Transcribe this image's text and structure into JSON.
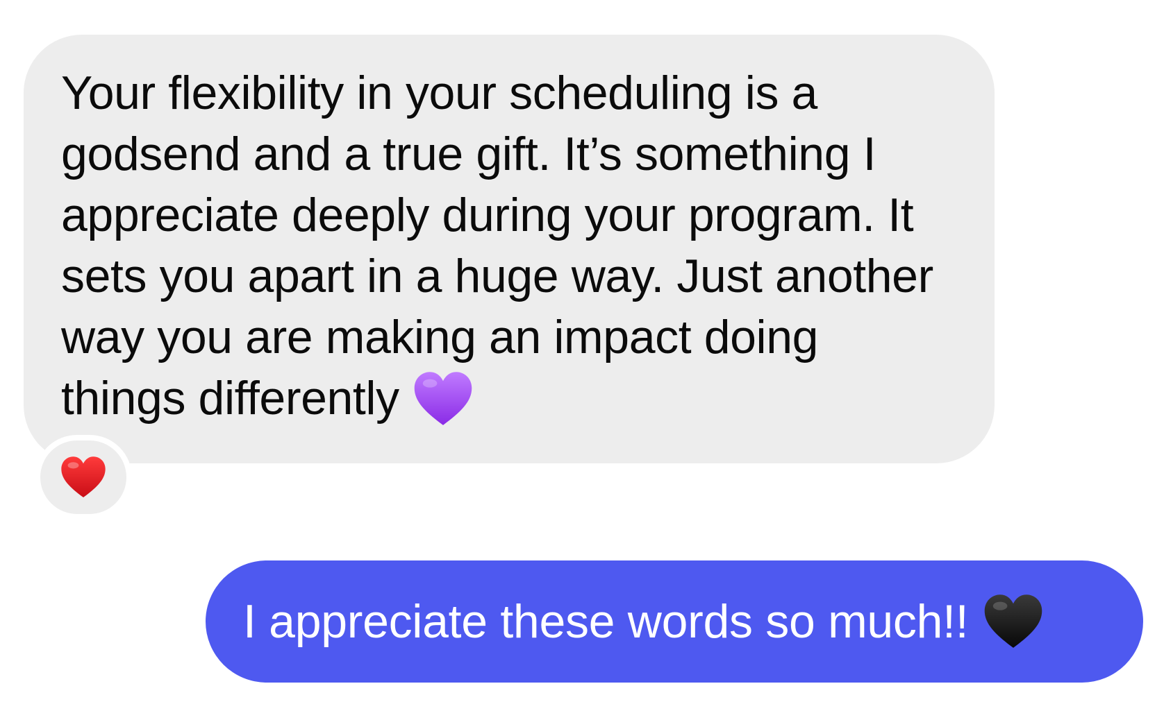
{
  "messages": [
    {
      "direction": "incoming",
      "text": "Your flexibility in your scheduling is a godsend and a true gift. It’s something I appreciate deeply during your program. It sets you apart in a huge way. Just another way you are making an impact doing things differently",
      "trailing_icon": "purple-heart-emoji",
      "reaction": "red-heart-emoji",
      "bubble_color": "#ededed"
    },
    {
      "direction": "outgoing",
      "text": "I appreciate these words so much!!",
      "trailing_icon": "black-heart-emoji",
      "bubble_color": "#4e59f0"
    }
  ],
  "colors": {
    "purple_heart": "#a24cf0",
    "red_heart": "#e3141d",
    "black_heart": "#141414"
  }
}
